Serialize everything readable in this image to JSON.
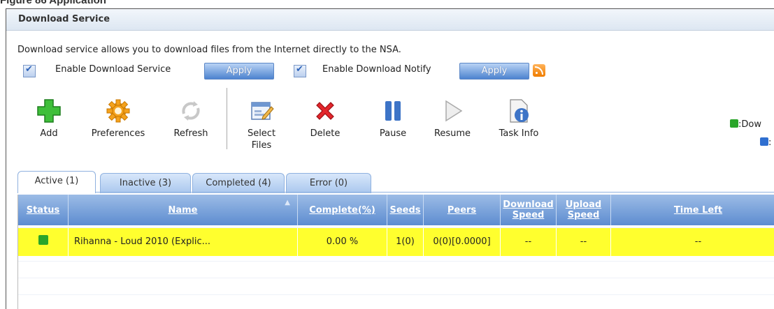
{
  "page": {
    "caption": "Figure 86 Application"
  },
  "panel": {
    "title": "Download Service",
    "description": "Download service allows you to download files from the Internet directly to the NSA.",
    "enable_service_label": "Enable Download Service",
    "enable_service_checked": true,
    "enable_notify_label": "Enable Download Notify",
    "enable_notify_checked": true,
    "apply_label": "Apply"
  },
  "toolbar": {
    "add": "Add",
    "preferences": "Preferences",
    "refresh": "Refresh",
    "select_files": "Select Files",
    "delete": "Delete",
    "pause": "Pause",
    "resume": "Resume",
    "task_info": "Task Info"
  },
  "legend": {
    "download": ":Dow",
    "upload": ":"
  },
  "tabs": [
    {
      "label": "Active (1)"
    },
    {
      "label": "Inactive (3)"
    },
    {
      "label": "Completed (4)"
    },
    {
      "label": "Error (0)"
    }
  ],
  "table": {
    "headers": {
      "status": "Status",
      "name": "Name",
      "complete": "Complete(%)",
      "seeds": "Seeds",
      "peers": "Peers",
      "download_speed": "Download Speed",
      "upload_speed": "Upload Speed",
      "time_left": "Time Left"
    },
    "rows": [
      {
        "status_icon": "download-arrow-icon",
        "name": "Rihanna - Loud 2010 (Explic...",
        "complete": "0.00 %",
        "seeds": "1(0)",
        "peers": "0(0)[0.0000]",
        "download_speed": "--",
        "upload_speed": "--",
        "time_left": "--"
      }
    ]
  },
  "colors": {
    "row_highlight": "#ffff2e",
    "header_blue": "#6b97d6",
    "apply_blue": "#4d83cf"
  }
}
